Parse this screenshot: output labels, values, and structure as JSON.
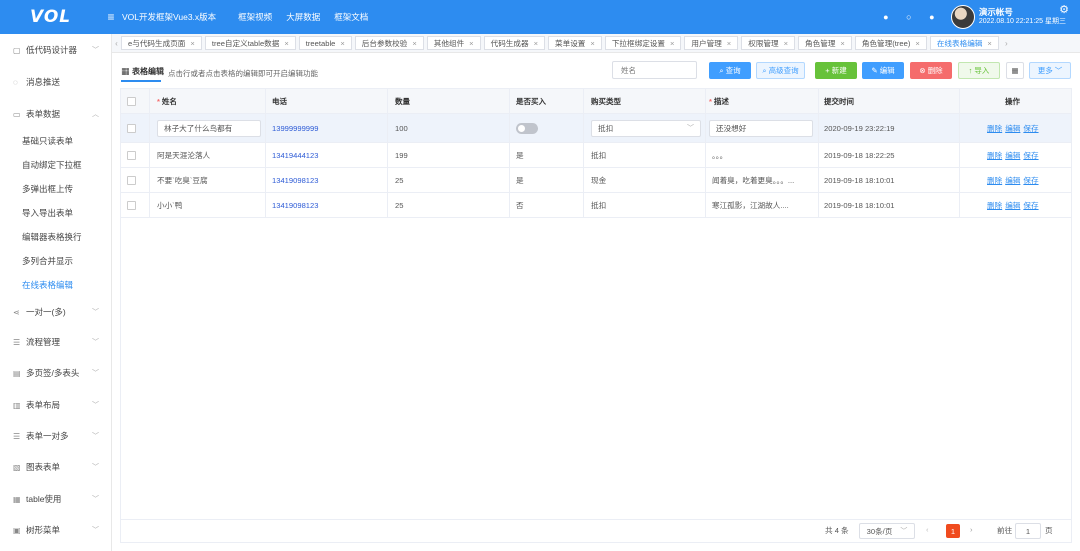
{
  "header": {
    "logo": "VOL",
    "app_title": "VOL开发框架Vue3.x版本",
    "links": [
      "框架视频",
      "大屏数据",
      "框架文档"
    ],
    "user_name": "演示帐号",
    "datetime": "2022.08.10 22:21:25 星期三",
    "accent": "#2d8cf0"
  },
  "sidebar": {
    "groups": [
      {
        "label": "低代码设计器",
        "icon": "doc-icon"
      },
      {
        "label": "消息推送",
        "icon": "chat-icon"
      },
      {
        "label": "表单数据",
        "icon": "form-icon"
      },
      {
        "label": "一对一(多)",
        "icon": "share-icon"
      },
      {
        "label": "流程管理",
        "icon": "sliders-icon"
      },
      {
        "label": "多页签/多表头",
        "icon": "tabs-icon"
      },
      {
        "label": "表单布局",
        "icon": "layout-icon"
      },
      {
        "label": "表单一对多",
        "icon": "sliders-icon"
      },
      {
        "label": "图表表单",
        "icon": "chart-icon"
      },
      {
        "label": "table使用",
        "icon": "table-icon"
      },
      {
        "label": "树形菜单",
        "icon": "tree-icon"
      }
    ],
    "subitems": [
      "基础只读表单",
      "自动绑定下拉框",
      "多弹出框上传",
      "导入导出表单",
      "编辑器表格换行",
      "多列合并显示",
      "在线表格编辑"
    ]
  },
  "tabs": [
    "e与代码生成页面",
    "tree自定义table数据",
    "treetable",
    "后台参数校验",
    "其他组件",
    "代码生成器",
    "菜单设置",
    "下拉框绑定设置",
    "用户管理",
    "权限管理",
    "角色管理",
    "角色管理(tree)",
    "在线表格编辑"
  ],
  "toolbar": {
    "title": "表格编辑",
    "hint": "点击行或者点击表格的编辑即可开启编辑功能",
    "search_placeholder": "姓名",
    "buttons": {
      "query": "查询",
      "advanced": "高级查询",
      "add": "新建",
      "edit": "编辑",
      "delete": "删除",
      "import": "导入",
      "more": "更多"
    }
  },
  "table": {
    "columns": [
      "姓名",
      "电话",
      "数量",
      "是否买入",
      "购买类型",
      "描述",
      "提交时间",
      "操作"
    ],
    "rows": [
      {
        "name": "林子大了什么鸟都有",
        "phone": "13999999999",
        "qty": "100",
        "bought": "",
        "type": "抵扣",
        "desc": "还没想好",
        "time": "2020-09-19 23:22:19"
      },
      {
        "name": "阿是天涯沦落人",
        "phone": "13419444123",
        "qty": "199",
        "bought": "是",
        "type": "抵扣",
        "desc": "。。。",
        "time": "2019-09-18 18:22:25"
      },
      {
        "name": "不要`吃臭`豆腐",
        "phone": "13419098123",
        "qty": "25",
        "bought": "是",
        "type": "现金",
        "desc": "闻着臭，吃着更臭。。。...",
        "time": "2019-09-18 18:10:01"
      },
      {
        "name": "小小`鸭",
        "phone": "13419098123",
        "qty": "25",
        "bought": "否",
        "type": "抵扣",
        "desc": "寒江孤影，江湖故人....",
        "time": "2019-09-18 18:10:01"
      }
    ],
    "ops": [
      "删除",
      "编辑",
      "保存"
    ]
  },
  "pager": {
    "total": "共 4 条",
    "page_size": "30条/页",
    "current": "1",
    "goto_label": "前往",
    "goto_value": "1",
    "page_unit": "页"
  }
}
